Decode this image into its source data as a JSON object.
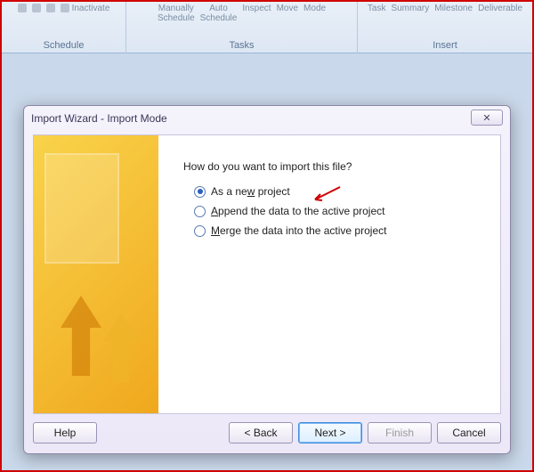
{
  "ribbon": {
    "schedule": {
      "label": "Schedule",
      "inactivate": "Inactivate"
    },
    "tasks": {
      "label": "Tasks",
      "manually": "Manually",
      "schedule1": "Schedule",
      "auto": "Auto",
      "schedule2": "Schedule",
      "inspect": "Inspect",
      "move": "Move",
      "mode": "Mode"
    },
    "insert": {
      "label": "Insert",
      "task": "Task",
      "summary": "Summary",
      "milestone": "Milestone",
      "deliverable": "Deliverable"
    }
  },
  "dialog": {
    "title": "Import Wizard - Import Mode",
    "close": "✕",
    "question": "How do you want to import this file?",
    "options": {
      "new_pre": "As a ne",
      "new_u": "w",
      "new_post": " project",
      "append_u": "A",
      "append_post": "ppend the data to the active project",
      "merge_u": "M",
      "merge_post": "erge the data into the active project"
    },
    "buttons": {
      "help": "Help",
      "back": "< Back",
      "next": "Next >",
      "finish": "Finish",
      "cancel": "Cancel"
    }
  }
}
